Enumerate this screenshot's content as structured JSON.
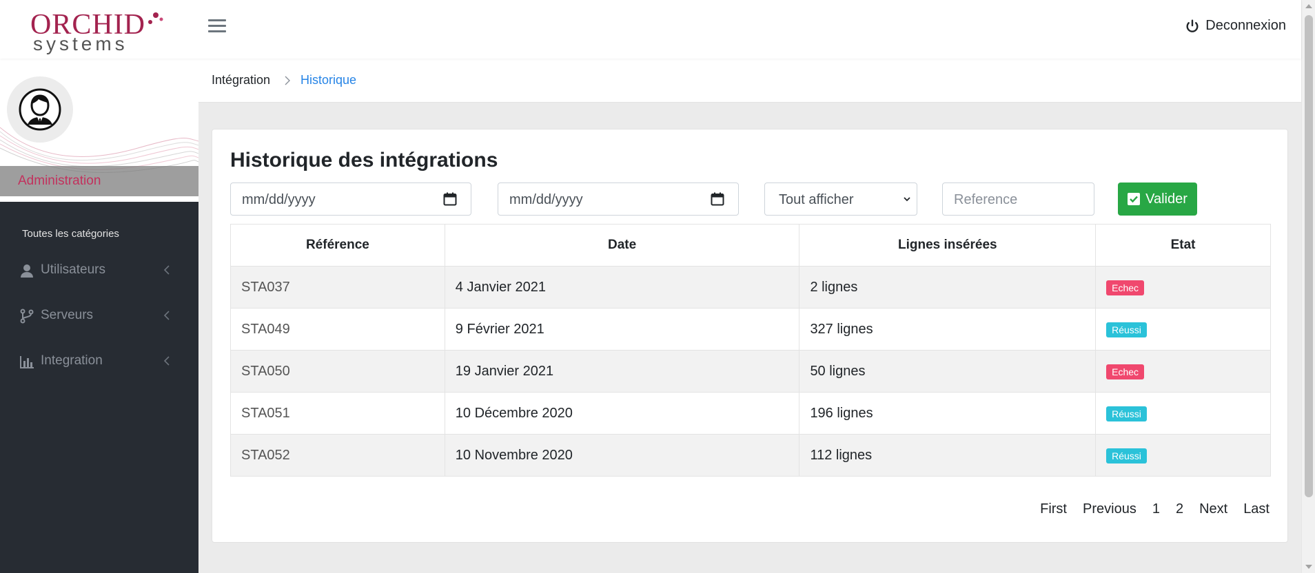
{
  "header": {
    "logo_brand": "ORCHID",
    "logo_sub": "systems",
    "logout_label": "Deconnexion"
  },
  "sidebar": {
    "role_label": "Administration",
    "categories_title": "Toutes les catégories",
    "items": [
      {
        "label": "Utilisateurs",
        "icon": "user-icon"
      },
      {
        "label": "Serveurs",
        "icon": "branch-icon"
      },
      {
        "label": "Integration",
        "icon": "bar-chart-icon"
      }
    ]
  },
  "breadcrumb": {
    "parent": "Intégration",
    "current": "Historique"
  },
  "main": {
    "title": "Historique des intégrations",
    "filters": {
      "date_from_placeholder": "mm/dd/yyyy",
      "date_to_placeholder": "mm/dd/yyyy",
      "status_selected": "Tout afficher",
      "reference_placeholder": "Reference",
      "submit_label": "Valider"
    },
    "table": {
      "columns": [
        "Référence",
        "Date",
        "Lignes insérées",
        "Etat"
      ],
      "rows": [
        {
          "ref": "STA037",
          "date": "4 Janvier 2021",
          "lines": "2 lignes",
          "status": "Echec"
        },
        {
          "ref": "STA049",
          "date": "9 Février 2021",
          "lines": "327 lignes",
          "status": "Réussi"
        },
        {
          "ref": "STA050",
          "date": "19 Janvier 2021",
          "lines": "50 lignes",
          "status": "Echec"
        },
        {
          "ref": "STA051",
          "date": "10 Décembre 2020",
          "lines": "196 lignes",
          "status": "Réussi"
        },
        {
          "ref": "STA052",
          "date": "10 Novembre 2020",
          "lines": "112 lignes",
          "status": "Réussi"
        }
      ]
    },
    "pagination": {
      "first": "First",
      "previous": "Previous",
      "pages": [
        "1",
        "2"
      ],
      "next": "Next",
      "last": "Last"
    }
  },
  "colors": {
    "brand": "#a3234f",
    "link": "#2684e6",
    "success_button": "#28a745",
    "badge_fail": "#f0486e",
    "badge_ok": "#2bc2d9",
    "sidebar_bg": "#272c33"
  }
}
